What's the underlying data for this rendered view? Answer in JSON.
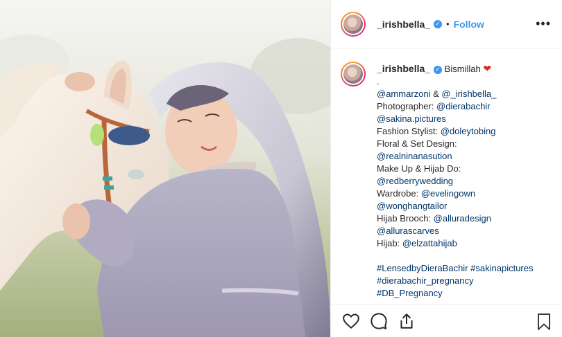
{
  "post": {
    "username": "_irishbella_",
    "separator": "•",
    "follow_label": "Follow",
    "more_label": "•••"
  },
  "caption": {
    "username": "_irishbella_",
    "first_text": "Bismillah",
    "heart": "❤",
    "lines": [
      [
        {
          "t": "."
        }
      ],
      [
        {
          "t": "@ammarzoni",
          "m": true
        },
        {
          "t": " & "
        },
        {
          "t": "@_irishbella_",
          "m": true
        }
      ],
      [
        {
          "t": "Photographer: "
        },
        {
          "t": "@dierabachir",
          "m": true
        }
      ],
      [
        {
          "t": "@sakina.pictures",
          "m": true
        }
      ],
      [
        {
          "t": "Fashion Stylist: "
        },
        {
          "t": "@doleytobing",
          "m": true
        }
      ],
      [
        {
          "t": "Floral & Set Design:"
        }
      ],
      [
        {
          "t": "@realninanasution",
          "m": true
        }
      ],
      [
        {
          "t": "Make Up & Hijab Do:"
        }
      ],
      [
        {
          "t": "@redberrywedding",
          "m": true
        }
      ],
      [
        {
          "t": "Wardrobe: "
        },
        {
          "t": "@evelingown",
          "m": true
        }
      ],
      [
        {
          "t": "@wonghangtailor",
          "m": true
        }
      ],
      [
        {
          "t": "Hijab Brooch: "
        },
        {
          "t": "@alluradesign",
          "m": true
        }
      ],
      [
        {
          "t": "@allurascarves",
          "m": true
        }
      ],
      [
        {
          "t": "Hijab: "
        },
        {
          "t": "@elzattahijab",
          "m": true
        }
      ],
      [],
      [
        {
          "t": "#LensedbyDieraBachir",
          "h": true
        },
        {
          "t": " "
        },
        {
          "t": "#sakinapictures",
          "h": true
        }
      ],
      [
        {
          "t": "#dierabachir_pregnancy",
          "h": true
        }
      ],
      [
        {
          "t": "#DB_Pregnancy",
          "h": true
        }
      ]
    ]
  },
  "icons": {
    "verified": "verified-badge-icon",
    "like": "heart-outline-icon",
    "comment": "comment-bubble-icon",
    "share": "share-upload-icon",
    "save": "bookmark-icon"
  },
  "colors": {
    "link": "#003569",
    "follow": "#3897f0",
    "verified": "#3897f0"
  }
}
